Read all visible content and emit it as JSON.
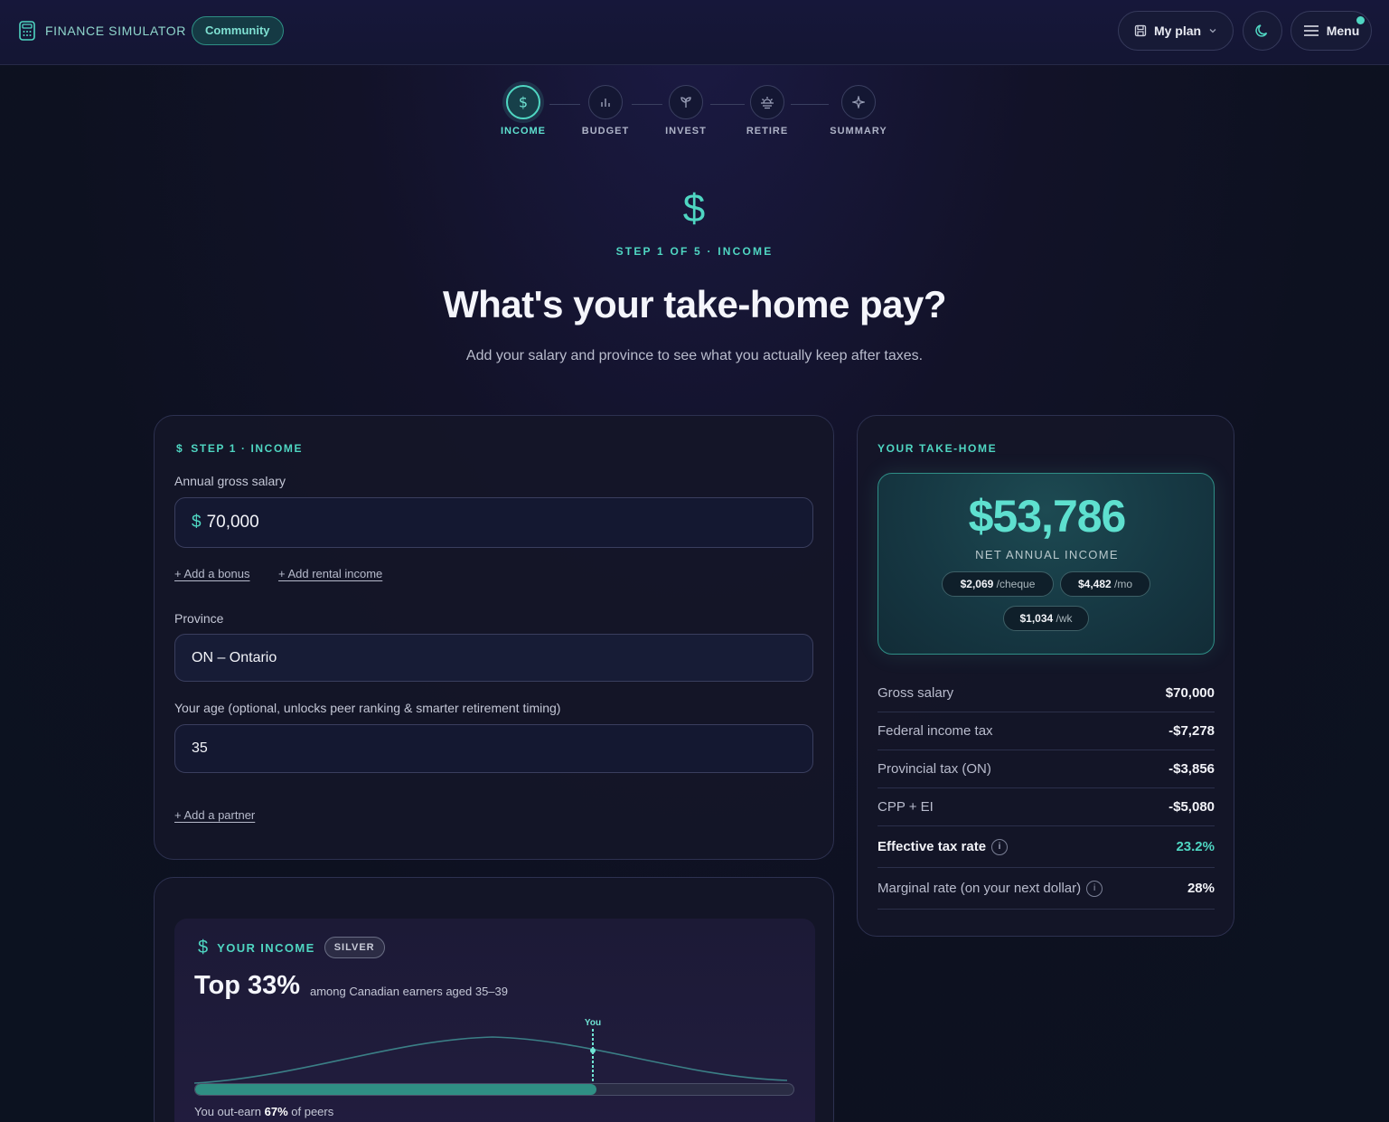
{
  "header": {
    "brand": "FINANCE SIMULATOR",
    "badge": "Community",
    "plan_label": "My plan",
    "menu_label": "Menu"
  },
  "stepper": {
    "steps": [
      {
        "label": "INCOME",
        "icon": "dollar-icon",
        "active": true
      },
      {
        "label": "BUDGET",
        "icon": "bar-chart-icon",
        "active": false
      },
      {
        "label": "INVEST",
        "icon": "sprout-icon",
        "active": false
      },
      {
        "label": "RETIRE",
        "icon": "sunset-icon",
        "active": false
      },
      {
        "label": "SUMMARY",
        "icon": "sparkle-icon",
        "active": false
      }
    ]
  },
  "hero": {
    "icon": "$",
    "step": "STEP 1 OF 5 · INCOME",
    "title": "What's your take-home pay?",
    "subtitle": "Add your salary and province to see what you actually keep after taxes."
  },
  "income": {
    "section": "STEP 1 · INCOME",
    "section_icon": "$",
    "salary_label": "Annual gross salary",
    "currency": "$",
    "salary_value": "70,000",
    "add_bonus": "+ Add a bonus",
    "add_rental": "+ Add rental income",
    "province_label": "Province",
    "province_value": "ON – Ontario",
    "age_label": "Your age (optional, unlocks peer ranking & smarter retirement timing)",
    "age_value": "35",
    "add_partner": "+ Add a partner"
  },
  "takehome": {
    "section": "YOUR TAKE-HOME",
    "net_value": "$53,786",
    "net_label": "NET ANNUAL INCOME",
    "cheque_value": "$2,069",
    "cheque_unit": "/cheque",
    "month_value": "$4,482",
    "month_unit": "/mo",
    "week_value": "$1,034",
    "week_unit": "/wk",
    "rows": [
      {
        "k": "Gross salary",
        "v": "$70,000"
      },
      {
        "k": "Federal income tax",
        "v": "-$7,278"
      },
      {
        "k": "Provincial tax (ON)",
        "v": "-$3,856"
      },
      {
        "k": "CPP + EI",
        "v": "-$5,080"
      },
      {
        "k": "Effective tax rate",
        "v": "23.2%"
      },
      {
        "k": "Marginal rate (on your next dollar)",
        "v": "28%"
      }
    ]
  },
  "rank": {
    "icon": "$",
    "label": "YOUR INCOME",
    "tier": "SILVER",
    "title": "Top 33%",
    "subtitle": "among Canadian earners aged 35–39",
    "marker": "You",
    "percentile": 67,
    "outearn_prefix": "You out-earn",
    "outearn_value": "67%",
    "outearn_suffix": "of peers"
  },
  "colors": {
    "accent": "#4fd6c2",
    "background": "#121228",
    "card": "#141628"
  }
}
